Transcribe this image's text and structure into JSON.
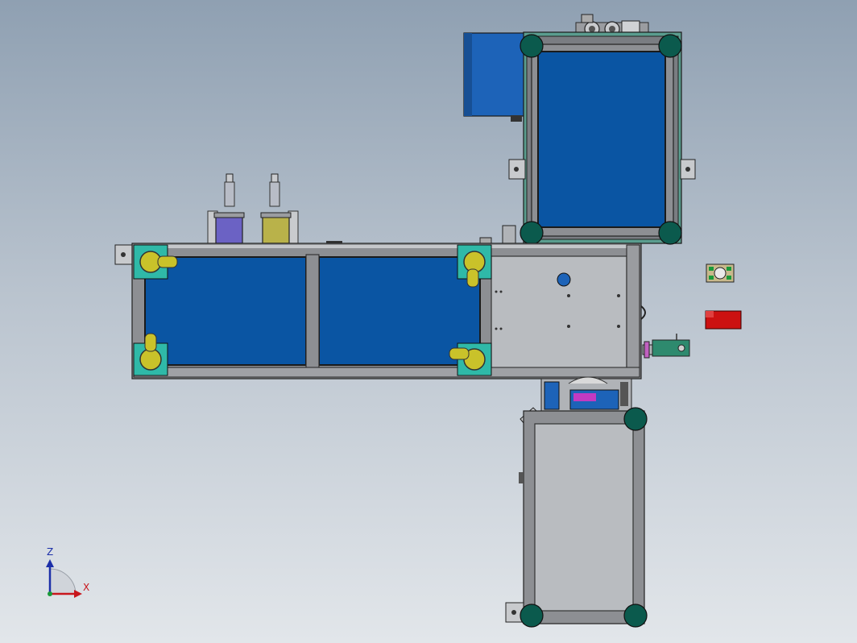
{
  "view": {
    "background_top": "#8fa0b2",
    "background_bottom": "#e2e6ea"
  },
  "colors": {
    "frame": "#8d8f93",
    "frame_dark": "#3f4246",
    "panel_blue": "#0a55a3",
    "plate_gray": "#b9bcc0",
    "caster_yellow": "#c9c22a",
    "corner_teal": "#2fb9a8",
    "foot_green": "#0b5a4d",
    "motor_blue": "#1d63b8",
    "part_red": "#cc1111",
    "cylinder_purple": "#6b62c4",
    "cylinder_olive": "#b9b24a"
  },
  "triad": {
    "z_label": "Z",
    "x_label": "X",
    "z_color": "#1c2fa8",
    "x_color": "#c8161c"
  }
}
